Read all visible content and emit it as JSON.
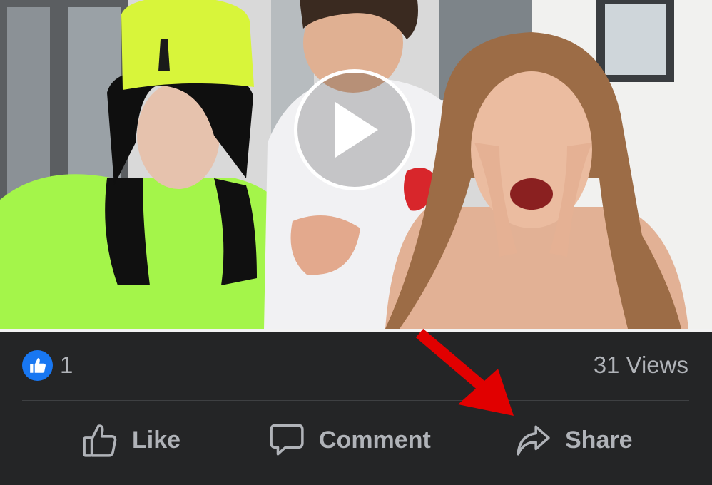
{
  "post": {
    "video": {
      "play_icon": "play-icon",
      "subject": "photo"
    },
    "stats": {
      "reaction_icon": "thumbs-up-icon",
      "reaction_color": "#1877f2",
      "like_count": "1",
      "views": "31 Views"
    },
    "actions": [
      {
        "label": "Like",
        "icon": "thumbs-up-outline-icon"
      },
      {
        "label": "Comment",
        "icon": "comment-bubble-icon"
      },
      {
        "label": "Share",
        "icon": "share-arrow-icon"
      }
    ]
  },
  "annotation": {
    "type": "arrow",
    "color": "#e10000",
    "points_to": "Share"
  },
  "colors": {
    "background": "#242526",
    "text_secondary": "#b0b3b8",
    "separator": "#3e4042"
  }
}
